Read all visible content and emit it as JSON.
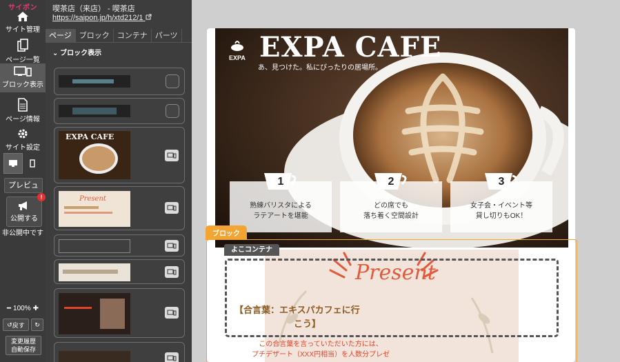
{
  "rail": {
    "brand": "サイポン",
    "items": [
      {
        "label": "サイト管理"
      },
      {
        "label": "ページ一覧"
      },
      {
        "label": "ブロック表示"
      },
      {
        "label": "ページ情報"
      },
      {
        "label": "サイト設定"
      }
    ],
    "preview": "プレビュー",
    "publish": "公開する",
    "publish_badge": "!",
    "status": "非公開中です",
    "zoom": "100%",
    "undo": "戻す",
    "history": "変更履歴",
    "autosave": "自動保存"
  },
  "panel": {
    "shop": "喫茶店（来店） - 喫茶店",
    "url": "https://saipon.jp/h/xtd212/1",
    "tabs": [
      "ページ",
      "ブロック",
      "コンテナ",
      "パーツ"
    ],
    "section": "ブロック表示",
    "thumb_texts": {
      "cafe": "EXPA CAFE",
      "present": "Present"
    }
  },
  "canvas": {
    "hero_title": "EXPA CAFE",
    "logo_text": "EXPA",
    "tagline": "あ、見つけた。私にぴったりの居場所。",
    "features": [
      {
        "num": "1",
        "line1": "熟練バリスタによる",
        "line2": "ラテアートを堪能"
      },
      {
        "num": "2",
        "line1": "どの席でも",
        "line2": "落ち着く空間設計"
      },
      {
        "num": "3",
        "line1": "女子会・イベント等",
        "line2": "貸し切りもOK！"
      }
    ],
    "block_label": "ブロック",
    "container_label": "よこコンテナ",
    "present": "Present",
    "keyword_line1": "【合言葉：エキスパカフェに行",
    "keyword_line2": "こう】",
    "desc_line1": "この合言葉を言っていただいた方には、",
    "desc_line2": "プチデザート（XXX円相当）を人数分プレゼ"
  }
}
